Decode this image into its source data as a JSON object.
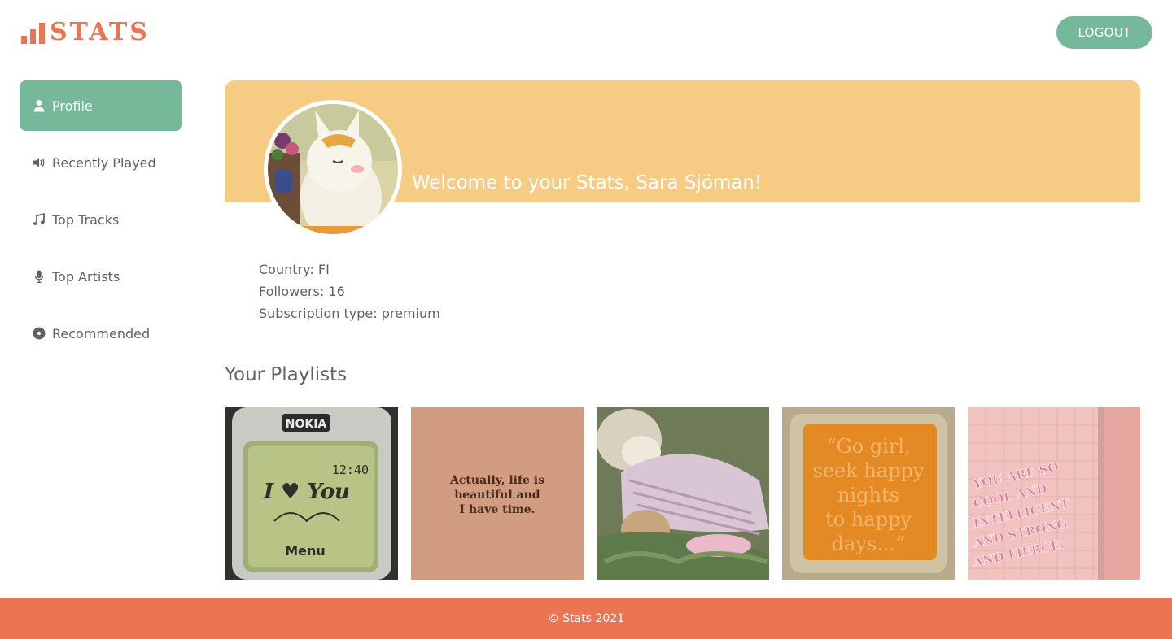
{
  "header": {
    "logo_text": "STATS",
    "logout_label": "LOGOUT"
  },
  "sidebar": {
    "items": [
      {
        "label": "Profile",
        "icon": "user-icon",
        "active": true
      },
      {
        "label": "Recently Played",
        "icon": "speaker-icon",
        "active": false
      },
      {
        "label": "Top Tracks",
        "icon": "music-note-icon",
        "active": false
      },
      {
        "label": "Top Artists",
        "icon": "microphone-icon",
        "active": false
      },
      {
        "label": "Recommended",
        "icon": "record-icon",
        "active": false
      }
    ]
  },
  "profile": {
    "welcome": "Welcome to your Stats, Sara Sjöman!",
    "country": "Country: FI",
    "followers": "Followers: 16",
    "subscription": "Subscription type: premium"
  },
  "playlists": {
    "title": "Your Playlists",
    "items": [
      {
        "cover_text": "NOKIA",
        "screen_time": "12:40",
        "screen_menu": "Menu",
        "screen_text": "I ♥ You"
      },
      {
        "cover_lines": [
          "Actually, life is",
          "beautiful and",
          "I have time."
        ]
      },
      {
        "cover_text": ""
      },
      {
        "cover_lines": [
          "“Go girl,",
          "seek happy",
          "nights",
          "to happy",
          "days...”"
        ]
      },
      {
        "cover_lines": [
          "YOU ARE SO",
          "COOL AND",
          "INTELLIGENT",
          "AND STRONG",
          "AND FIERCE."
        ]
      }
    ]
  },
  "footer": {
    "text": "© Stats 2021"
  },
  "colors": {
    "accent_orange": "#ec7453",
    "accent_green": "#75b99a",
    "banner_yellow": "#f6cc85",
    "text_gray": "#5f6368"
  }
}
